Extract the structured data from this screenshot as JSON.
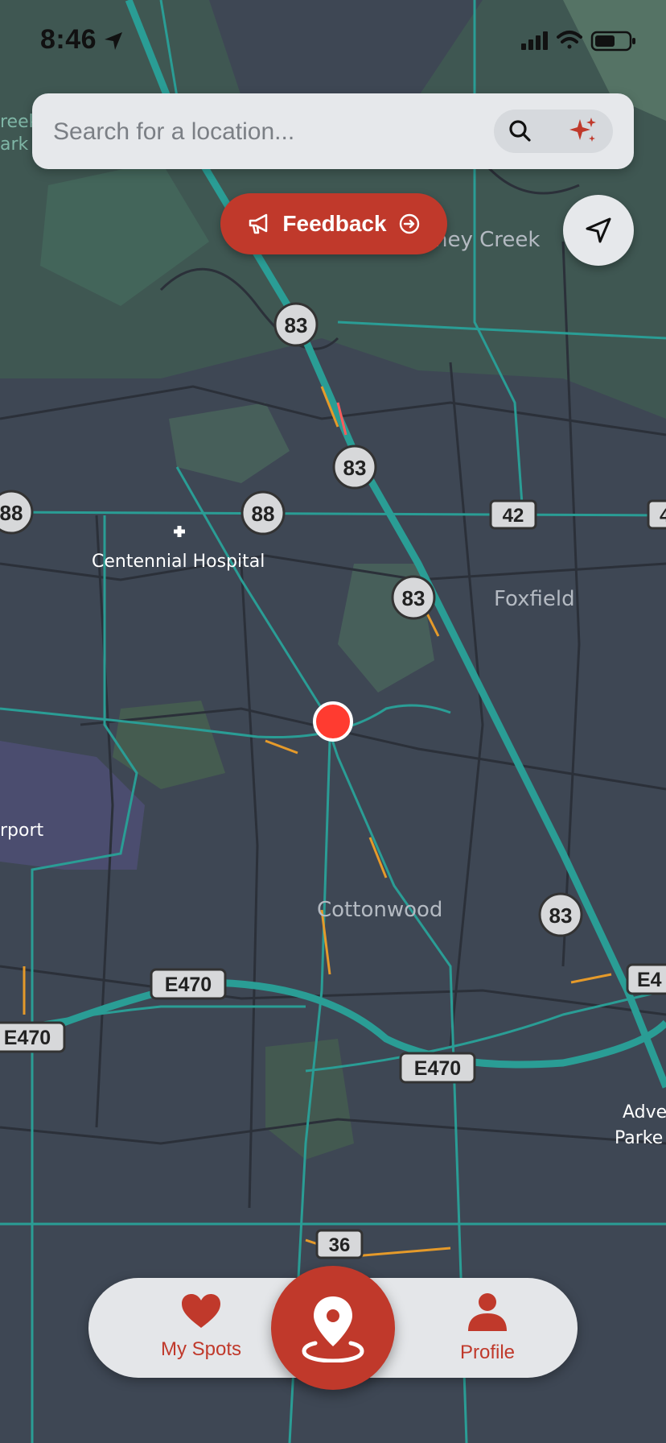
{
  "status": {
    "time": "8:46"
  },
  "search": {
    "placeholder": "Search for a location..."
  },
  "feedback": {
    "label": "Feedback"
  },
  "map": {
    "places": [
      "ney Creek",
      "Foxfield",
      "Cottonwood",
      "Centennial Hospital",
      "rport",
      "reek",
      "ark",
      "Adve",
      "Parke"
    ],
    "route_shields": [
      "83",
      "83",
      "83",
      "83",
      "88",
      "88",
      "42",
      "4",
      "36"
    ],
    "interstate_shields": [
      "E470",
      "E470",
      "E470",
      "E4"
    ]
  },
  "nav": {
    "my_spots": "My Spots",
    "profile": "Profile"
  },
  "colors": {
    "accent": "#c0392b",
    "map_bg": "#3e4754",
    "road": "#2a9d95",
    "marker": "#ff3b30"
  }
}
